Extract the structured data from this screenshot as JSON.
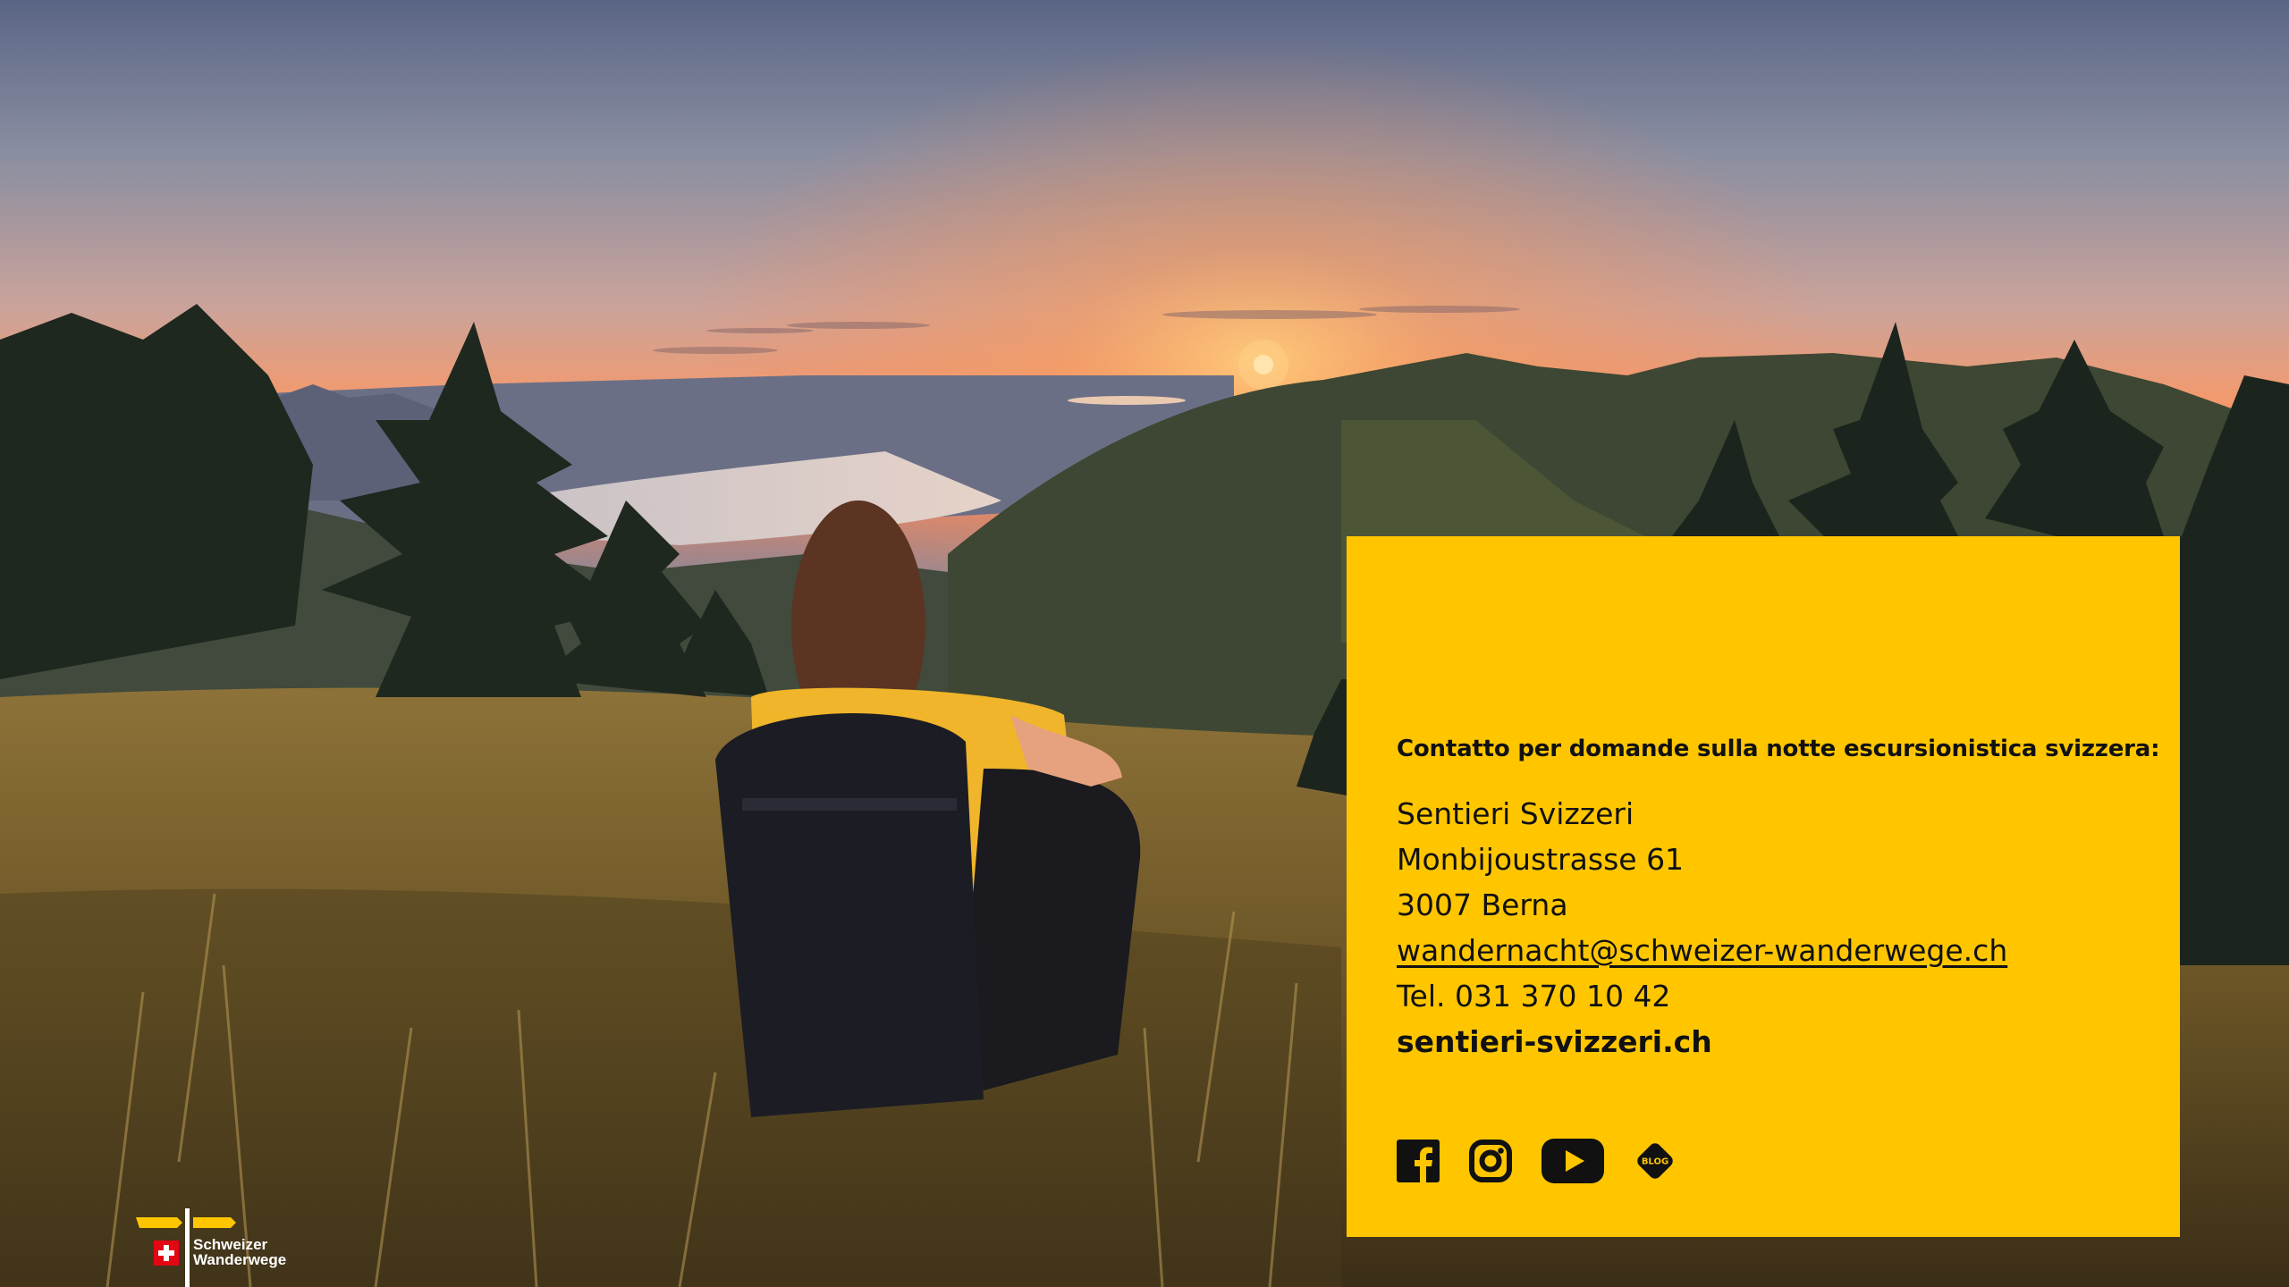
{
  "contact": {
    "heading": "Contatto per domande sulla notte escursionistica svizzera:",
    "org": "Sentieri Svizzeri",
    "street": "Monbijoustrasse 61",
    "city": "3007 Berna",
    "email": "wandernacht@schweizer-wanderwege.ch",
    "phone": "Tel. 031 370 10 42",
    "website": "sentieri-svizzeri.ch"
  },
  "socials": [
    {
      "icon": "facebook-icon"
    },
    {
      "icon": "instagram-icon"
    },
    {
      "icon": "youtube-icon"
    },
    {
      "icon": "blog-icon",
      "label": "BLOG"
    }
  ],
  "logo": {
    "line1": "Schweizer",
    "line2": "Wanderwege"
  },
  "colors": {
    "panel": "#ffc600",
    "text": "#111111",
    "sun": "#ffd38a"
  }
}
